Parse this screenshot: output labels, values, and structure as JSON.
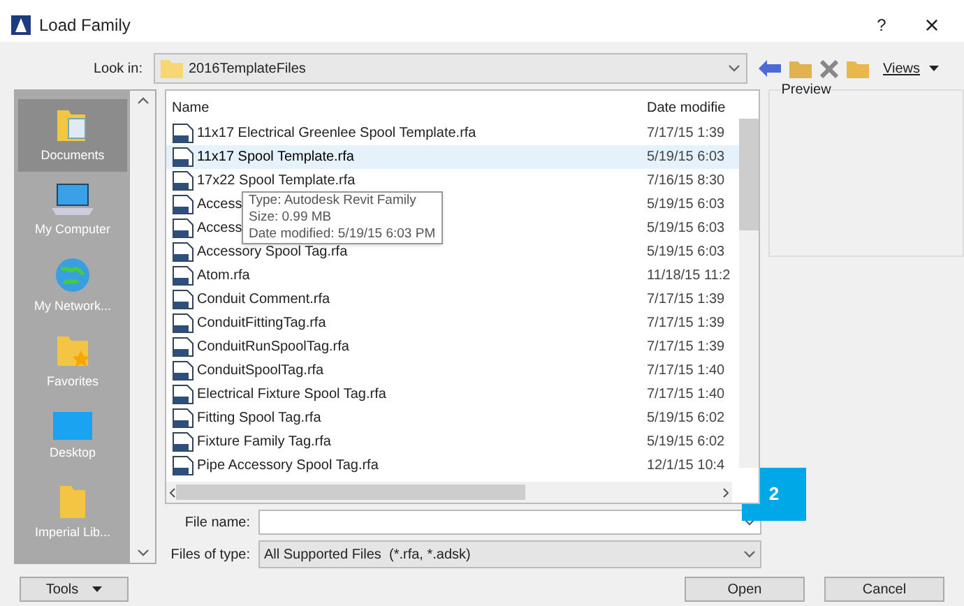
{
  "window": {
    "title": "Load Family",
    "help": "?",
    "close": "×"
  },
  "look_in": {
    "label": "Look in:",
    "value": "2016TemplateFiles"
  },
  "toolbar": {
    "views": "Views",
    "preview": "Preview"
  },
  "places": [
    {
      "label": "Documents",
      "kind": "documents",
      "selected": true
    },
    {
      "label": "My Computer",
      "kind": "computer",
      "selected": false
    },
    {
      "label": "My Network...",
      "kind": "network",
      "selected": false
    },
    {
      "label": "Favorites",
      "kind": "favorites",
      "selected": false
    },
    {
      "label": "Desktop",
      "kind": "desktop",
      "selected": false
    },
    {
      "label": "Imperial Lib...",
      "kind": "folder",
      "selected": false
    }
  ],
  "table": {
    "columns": [
      "Name",
      "Date modifie"
    ],
    "rows": [
      {
        "name": "11x17 Electrical Greenlee Spool Template.rfa",
        "date": "7/17/15 1:39",
        "selected": false
      },
      {
        "name": "11x17 Spool Template.rfa",
        "date": "5/19/15 6:03",
        "selected": true
      },
      {
        "name": "17x22 Spool Template.rfa",
        "date": "7/16/15 8:30",
        "selected": false
      },
      {
        "name": "Access",
        "date": "5/19/15 6:03",
        "selected": false
      },
      {
        "name": "Access",
        "date": "5/19/15 6:03",
        "selected": false
      },
      {
        "name": "Accessory Spool Tag.rfa",
        "date": "5/19/15 6:03",
        "selected": false
      },
      {
        "name": "Atom.rfa",
        "date": "11/18/15 11:2",
        "selected": false
      },
      {
        "name": "Conduit Comment.rfa",
        "date": "7/17/15 1:39",
        "selected": false
      },
      {
        "name": "ConduitFittingTag.rfa",
        "date": "7/17/15 1:39",
        "selected": false
      },
      {
        "name": "ConduitRunSpoolTag.rfa",
        "date": "7/17/15 1:39",
        "selected": false
      },
      {
        "name": "ConduitSpoolTag.rfa",
        "date": "7/17/15 1:40",
        "selected": false
      },
      {
        "name": "Electrical Fixture Spool Tag.rfa",
        "date": "7/17/15 1:40",
        "selected": false
      },
      {
        "name": "Fitting Spool Tag.rfa",
        "date": "5/19/15 6:02",
        "selected": false
      },
      {
        "name": "Fixture Family Tag.rfa",
        "date": "5/19/15 6:02",
        "selected": false
      },
      {
        "name": "Pipe Accessory Spool Tag.rfa",
        "date": "12/1/15 10:4",
        "selected": false
      }
    ]
  },
  "tooltip": [
    "Type: Autodesk Revit Family",
    "Size: 0.99 MB",
    "Date modified: 5/19/15 6:03 PM"
  ],
  "file_name": {
    "label": "File name:"
  },
  "files_of_type": {
    "label": "Files of type:",
    "value": "All Supported Files  (*.rfa, *.adsk)"
  },
  "badge": "2",
  "buttons": {
    "tools": "Tools",
    "open": "Open",
    "cancel": "Cancel"
  }
}
